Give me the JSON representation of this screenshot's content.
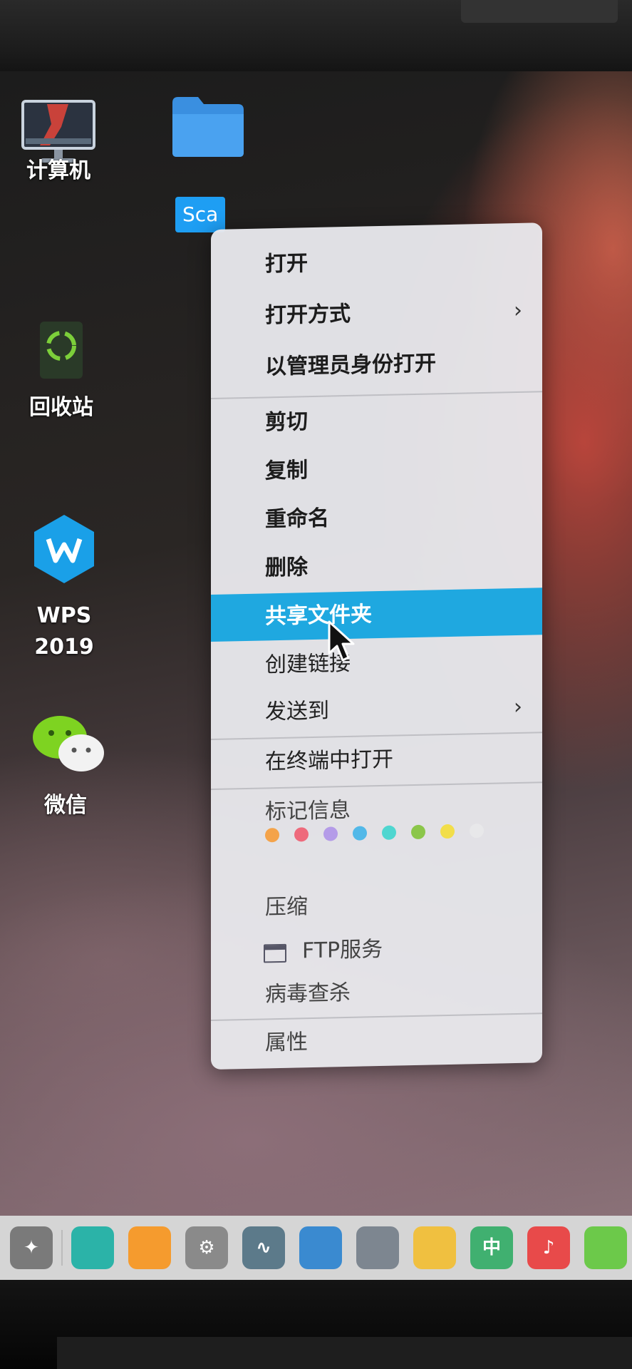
{
  "desktop": {
    "icons": [
      {
        "id": "computer",
        "label": "计算机"
      },
      {
        "id": "folder",
        "label": "Sca"
      },
      {
        "id": "recycle",
        "label": "回收站"
      },
      {
        "id": "wps",
        "label_line1": "WPS",
        "label_line2": "2019"
      },
      {
        "id": "wechat",
        "label": "微信"
      }
    ]
  },
  "context_menu": {
    "items": [
      {
        "label": "打开"
      },
      {
        "label": "打开方式",
        "submenu_arrow": "›"
      },
      {
        "label": "以管理员身份打开"
      },
      {
        "label": "剪切"
      },
      {
        "label": "复制"
      },
      {
        "label": "重命名"
      },
      {
        "label": "删除"
      },
      {
        "label": "共享文件夹",
        "highlighted": true
      },
      {
        "label": "创建链接"
      },
      {
        "label": "发送到",
        "submenu_arrow": "›"
      },
      {
        "label": "在终端中打开"
      },
      {
        "label": "标记信息"
      },
      {
        "label": "压缩"
      },
      {
        "label": "FTP服务",
        "icon": "window-icon"
      },
      {
        "label": "病毒查杀"
      },
      {
        "label": "属性"
      }
    ],
    "tag_colors": [
      "#f4a34a",
      "#ee6a7c",
      "#b49be8",
      "#52b8e8",
      "#4fd6d0",
      "#8bc64a",
      "#f2de4a",
      "#e8e8ea"
    ],
    "highlight_color": "#1fa8e0"
  },
  "dock": {
    "items": [
      {
        "name": "launcher-icon",
        "color": "#7a7a7a",
        "glyph": "✦"
      },
      {
        "name": "file-manager-icon",
        "color": "#2bb3a8",
        "glyph": ""
      },
      {
        "name": "app-store-icon",
        "color": "#f59b2e",
        "glyph": ""
      },
      {
        "name": "settings-icon",
        "color": "#8a8a8a",
        "glyph": "⚙"
      },
      {
        "name": "system-monitor-icon",
        "color": "#5c7a8a",
        "glyph": "∿"
      },
      {
        "name": "code-editor-icon",
        "color": "#3a8ad0",
        "glyph": ""
      },
      {
        "name": "printer-icon",
        "color": "#7d8690",
        "glyph": ""
      },
      {
        "name": "browser-icon",
        "color": "#f0c040",
        "glyph": ""
      },
      {
        "name": "input-method-icon",
        "color": "#40b070",
        "glyph": "中"
      },
      {
        "name": "music-icon",
        "color": "#e84a4a",
        "glyph": "♪"
      },
      {
        "name": "wechat-dock-icon",
        "color": "#6cc94a",
        "glyph": ""
      }
    ]
  }
}
